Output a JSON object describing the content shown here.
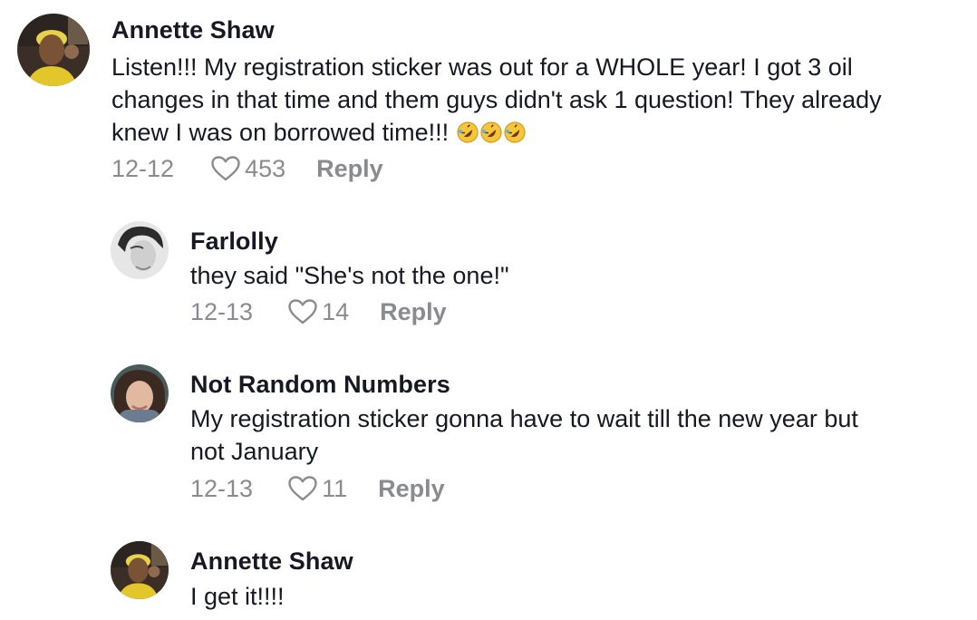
{
  "comments": [
    {
      "author": "Annette Shaw",
      "text_line1": "Listen!!! My registration sticker was out for a WHOLE year! I got 3 oil",
      "text_line2": "changes in that time and them guys didn't ask 1 question! They already",
      "text_line3": "knew I was on borrowed time!!!",
      "emoji": "rolling-on-floor-laughing x3",
      "date": "12-12",
      "likes": "453",
      "reply_label": "Reply",
      "avatar_icon": "avatar-yellow-hair"
    },
    {
      "author": "Farlolly",
      "text_line1": "they said \"She's not the one!\"",
      "date": "12-13",
      "likes": "14",
      "reply_label": "Reply",
      "avatar_icon": "avatar-monochrome"
    },
    {
      "author": "Not Random Numbers",
      "text_line1": "My registration sticker gonna have to wait till the new year but",
      "text_line2": "not January",
      "date": "12-13",
      "likes": "11",
      "reply_label": "Reply",
      "avatar_icon": "avatar-selfie"
    },
    {
      "author": "Annette Shaw",
      "text_line1": "I get it!!!!",
      "avatar_icon": "avatar-yellow-hair"
    }
  ],
  "colors": {
    "text_primary": "#161823",
    "text_secondary": "#8a8b91",
    "background": "#ffffff"
  }
}
